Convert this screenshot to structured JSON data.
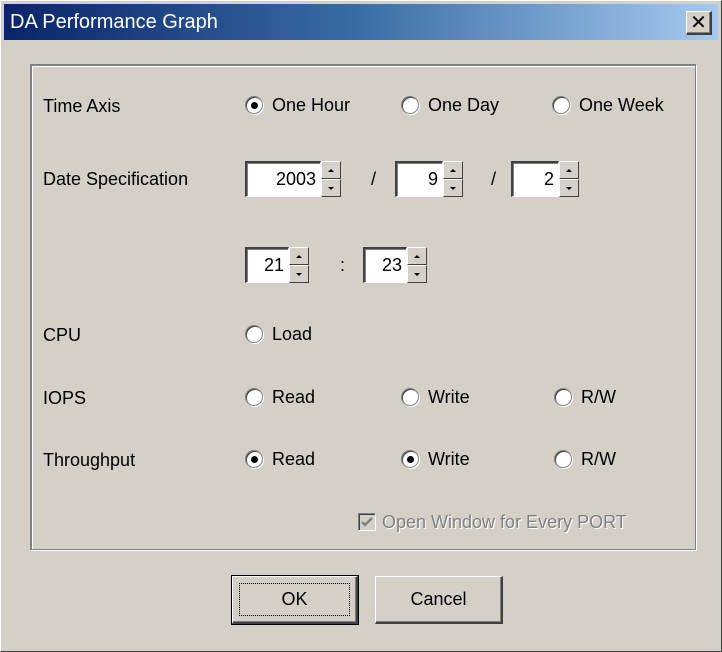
{
  "window": {
    "title": "DA Performance Graph"
  },
  "time_axis": {
    "label": "Time Axis",
    "options": [
      "One Hour",
      "One Day",
      "One Week"
    ],
    "selected": "One Hour"
  },
  "date_spec": {
    "label": "Date Specification",
    "year": "2003",
    "month": "9",
    "day": "2",
    "hour": "21",
    "minute": "23",
    "date_sep": "/",
    "time_sep": ":"
  },
  "cpu": {
    "label": "CPU",
    "load_label": "Load",
    "load_checked": false
  },
  "iops": {
    "label": "IOPS",
    "read_label": "Read",
    "read_checked": false,
    "write_label": "Write",
    "write_checked": false,
    "rw_label": "R/W",
    "rw_checked": false
  },
  "throughput": {
    "label": "Throughput",
    "read_label": "Read",
    "read_checked": true,
    "write_label": "Write",
    "write_checked": true,
    "rw_label": "R/W",
    "rw_checked": false
  },
  "open_window": {
    "label": "Open Window for Every PORT",
    "checked": true,
    "enabled": false
  },
  "buttons": {
    "ok": "OK",
    "cancel": "Cancel"
  },
  "colors": {
    "title_bar_start": "#0a246a",
    "title_bar_end": "#a6caf0",
    "face": "#d4d0c8",
    "disabled_text": "#808080"
  }
}
